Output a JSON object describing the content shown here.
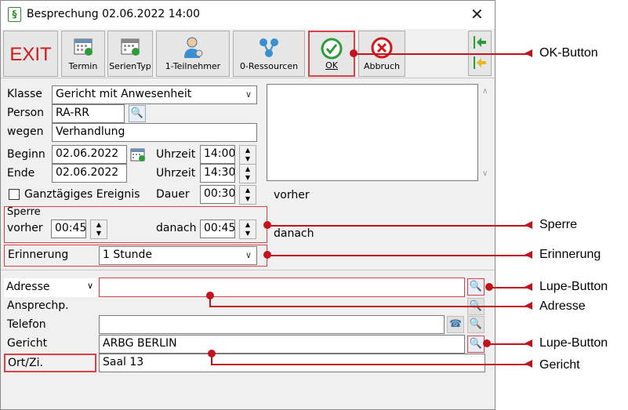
{
  "window": {
    "title": "Besprechung 02.06.2022 14:00",
    "close_symbol": "✕",
    "app_icon_glyph": "§"
  },
  "toolbar": {
    "exit_label": "EXIT",
    "buttons": [
      {
        "label": "Termin",
        "icon": "calendar-icon"
      },
      {
        "label": "SerienTyp",
        "icon": "series-calendar-icon"
      },
      {
        "label": "1-Teilnehmer",
        "icon": "participant-icon"
      },
      {
        "label": "0-Ressourcen",
        "icon": "resources-icon"
      },
      {
        "label": "OK",
        "icon": "check-icon"
      },
      {
        "label": "Abbruch",
        "icon": "cancel-icon"
      }
    ],
    "nav_icons": [
      "arrow-left-green-icon",
      "arrow-left-yellow-icon"
    ]
  },
  "form": {
    "klasse_label": "Klasse",
    "klasse_value": "Gericht mit Anwesenheit",
    "person_label": "Person",
    "person_value": "RA-RR",
    "wegen_label": "wegen",
    "wegen_value": "Verhandlung",
    "beginn_label": "Beginn",
    "beginn_value": "02.06.2022",
    "ende_label": "Ende",
    "ende_value": "02.06.2022",
    "uhrzeit_label": "Uhrzeit",
    "uhrzeit_begin": "14:00",
    "uhrzeit_end": "14:30",
    "ganztaegig_label": "Ganztägiges Ereignis",
    "dauer_label": "Dauer",
    "dauer_value": "00:30",
    "vorher_right": "vorher",
    "danach_right": "danach",
    "sperre_label": "Sperre",
    "sperre_vorher_label": "vorher",
    "sperre_vorher_value": "00:45",
    "sperre_danach_label": "danach",
    "sperre_danach_value": "00:45",
    "erinnerung_label": "Erinnerung",
    "erinnerung_value": "1 Stunde"
  },
  "address": {
    "type_value": "Adresse",
    "rows": [
      {
        "label": "Ansprechp.",
        "value": ""
      },
      {
        "label": "Telefon",
        "value": ""
      },
      {
        "label": "Gericht",
        "value": "ARBG BERLIN"
      },
      {
        "label": "Ort/Zi.",
        "value": "Saal 13"
      }
    ]
  },
  "callouts": {
    "ok_button": "OK-Button",
    "sperre": "Sperre",
    "erinnerung": "Erinnerung",
    "lupe1": "Lupe-Button",
    "adresse": "Adresse",
    "lupe2": "Lupe-Button",
    "gericht": "Gericht"
  },
  "colors": {
    "accent_red": "#c4121c",
    "exit_red": "#d01818",
    "check_green": "#2e9b3a"
  }
}
